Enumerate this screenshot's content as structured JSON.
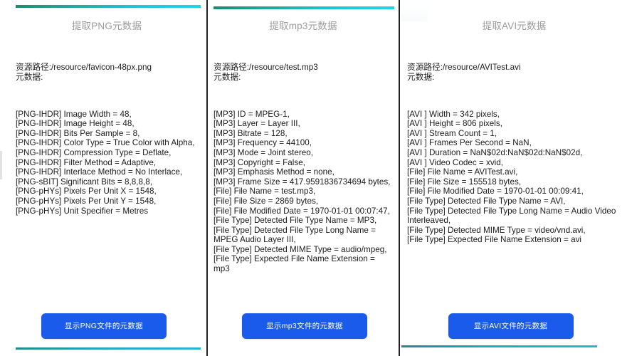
{
  "panels": [
    {
      "title": "提取PNG元数据",
      "resource_line": "资源路径:/resource/favicon-48px.png\n元数据:",
      "metadata": "[PNG-IHDR] Image Width = 48,\n[PNG-IHDR] Image Height = 48,\n[PNG-IHDR] Bits Per Sample = 8,\n[PNG-IHDR] Color Type = True Color with Alpha,\n[PNG-IHDR] Compression Type = Deflate,\n[PNG-IHDR] Filter Method = Adaptive,\n[PNG-IHDR] Interlace Method = No Interlace,\n[PNG-sBIT] Significant Bits = 8,8,8,8,\n[PNG-pHYs] Pixels Per Unit X = 1548,\n[PNG-pHYs] Pixels Per Unit Y = 1548,\n[PNG-pHYs] Unit Specifier = Metres",
      "button_label": "显示PNG文件的元数据"
    },
    {
      "title": "提取mp3元数据",
      "resource_line": "资源路径:/resource/test.mp3\n元数据:",
      "metadata": "[MP3] ID = MPEG-1,\n[MP3] Layer = Layer III,\n[MP3] Bitrate = 128,\n[MP3] Frequency = 44100,\n[MP3] Mode = Joint stereo,\n[MP3] Copyright = False,\n[MP3] Emphasis Method = none,\n[MP3] Frame Size = 417.9591836734694 bytes,\n[File] File Name = test.mp3,\n[File] File Size = 2869 bytes,\n[File] File Modified Date = 1970-01-01 00:07:47,\n[File Type] Detected File Type Name = MP3,\n[File Type] Detected File Type Long Name = MPEG Audio Layer III,\n[File Type] Detected MIME Type = audio/mpeg,\n[File Type] Expected File Name Extension = mp3",
      "button_label": "显示mp3文件的元数据"
    },
    {
      "title": "提取AVI元数据",
      "resource_line": "资源路径:/resource/AVITest.avi\n元数据:",
      "metadata": "[AVI ] Width = 342 pixels,\n[AVI ] Height = 806 pixels,\n[AVI ] Stream Count = 1,\n[AVI ] Frames Per Second = NaN,\n[AVI ] Duration = NaN$02d:NaN$02d:NaN$02d,\n[AVI ] Video Codec = xvid,\n[File] File Name = AVITest.avi,\n[File] File Size = 155518 bytes,\n[File] File Modified Date = 1970-01-01 00:09:41,\n[File Type] Detected File Type Name = AVI,\n[File Type] Detected File Type Long Name = Audio Video Interleaved,\n[File Type] Detected MIME Type = video/vnd.avi,\n[File Type] Expected File Name Extension = avi",
      "button_label": "显示AVI文件的元数据"
    }
  ],
  "colors": {
    "button_blue": "#1a5beb",
    "title_gray": "#9b9b9b",
    "stripe_green": "#1f8a6e",
    "stripe_cyan": "#22d3e8",
    "divider_dark": "#232323",
    "text_black": "#1c1c1c"
  }
}
